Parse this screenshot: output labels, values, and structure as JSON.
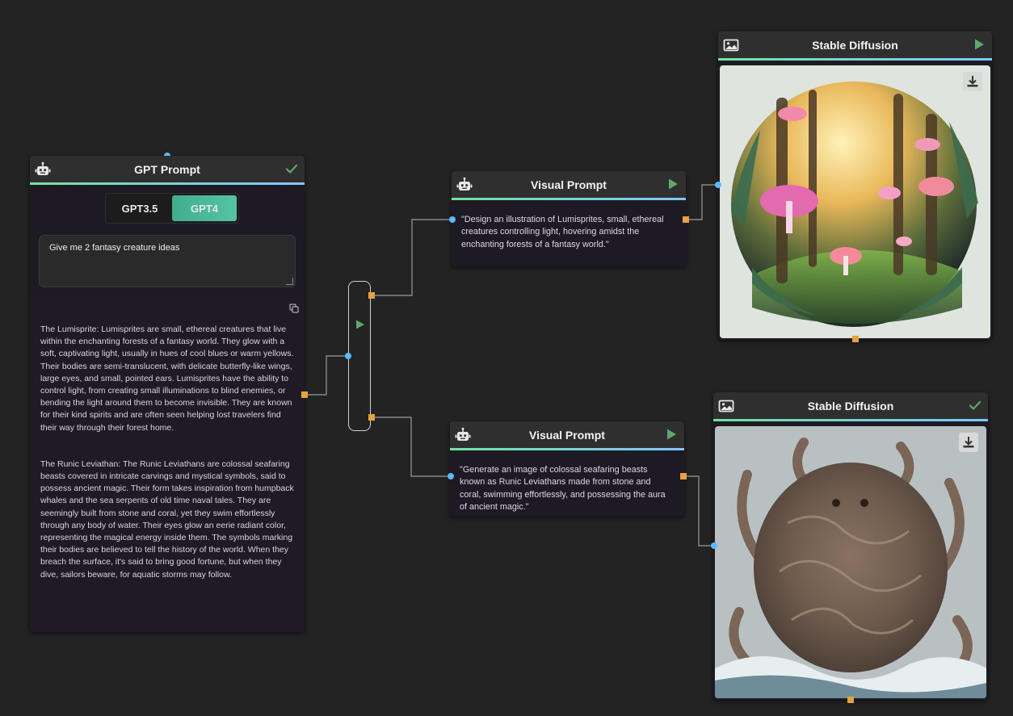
{
  "gpt_node": {
    "title": "GPT Prompt",
    "tabs": [
      {
        "label": "GPT3.5",
        "active": false
      },
      {
        "label": "GPT4",
        "active": true
      }
    ],
    "prompt_value": "Give me 2 fantasy creature ideas",
    "response": [
      "The Lumisprite: Lumisprites are small, ethereal creatures that live within the enchanting forests of a fantasy world. They glow with a soft, captivating light, usually in hues of cool blues or warm yellows. Their bodies are semi-translucent, with delicate butterfly-like wings, large eyes, and small, pointed ears. Lumisprites have the ability to control light, from creating small illuminations to blind enemies, or bending the light around them to become invisible. They are known for their kind spirits and are often seen helping lost travelers find their way through their forest home.",
      "The Runic Leviathan: The Runic Leviathans are colossal seafaring beasts covered in intricate carvings and mystical symbols, said to possess ancient magic. Their form takes inspiration from humpback whales and the sea serpents of old time naval tales. They are seemingly built from stone and coral, yet they swim effortlessly through any body of water. Their eyes glow an eerie radiant color, representing the magical energy inside them. The symbols marking their bodies are believed to tell the history of the world. When they breach the surface, it's said to bring good fortune, but when they dive, sailors beware, for aquatic storms may follow."
    ],
    "status_icon": "check-icon"
  },
  "visual_prompt_1": {
    "title": "Visual Prompt",
    "text": "\"Design an illustration of Lumisprites, small, ethereal creatures controlling light, hovering amidst the enchanting forests of a fantasy world.\""
  },
  "visual_prompt_2": {
    "title": "Visual Prompt",
    "text": "\"Generate an image of colossal seafaring beasts known as Runic Leviathans made from stone and coral, swimming effortlessly, and possessing the aura of ancient magic.\""
  },
  "stable_diffusion_1": {
    "title": "Stable Diffusion",
    "status_icon": "play-icon",
    "image_subject": "glowing mushroom fantasy forest in circular frame"
  },
  "stable_diffusion_2": {
    "title": "Stable Diffusion",
    "status_icon": "check-icon",
    "image_subject": "tentacled stone sea leviathan rising from waves"
  },
  "colors": {
    "canvas": "#232323",
    "node_body": "#1d1a24",
    "node_header": "#2f2f2f",
    "accent_green": "#6fe3a0",
    "accent_blue": "#7fc6ff",
    "input_port": "#5cb8ff",
    "output_port": "#e6a23c",
    "play_green": "#5fa86b"
  }
}
